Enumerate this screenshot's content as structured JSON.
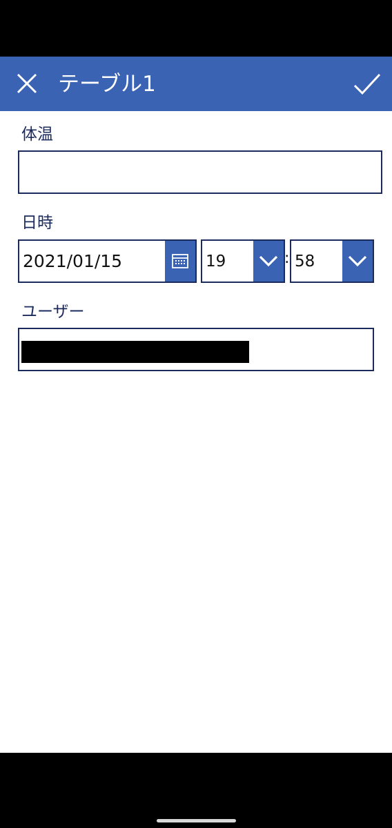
{
  "header": {
    "title": "テーブル1",
    "close_icon": "close-icon",
    "submit_icon": "checkmark-icon",
    "color": "#3a63b3"
  },
  "form": {
    "temperature": {
      "label": "体温",
      "value": ""
    },
    "datetime": {
      "label": "日時",
      "date": "2021/01/15",
      "hour": "19",
      "separator": ":",
      "minute": "58",
      "calendar_icon": "calendar-icon",
      "dropdown_icon": "chevron-down-icon"
    },
    "user": {
      "label": "ユーザー",
      "value_redacted": true
    }
  }
}
